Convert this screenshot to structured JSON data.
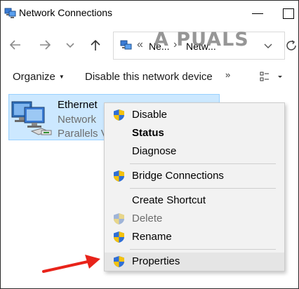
{
  "window": {
    "title": "Network Connections"
  },
  "navigation": {
    "breadcrumbs": [
      "Ne...",
      "Netw..."
    ]
  },
  "watermark": {
    "text": "A  PUALS"
  },
  "toolbar": {
    "organize_label": "Organize",
    "disable_label": "Disable this network device",
    "more_glyph": "»"
  },
  "connection": {
    "name": "Ethernet",
    "status": "Network",
    "device": "Parallels Vi"
  },
  "context_menu": {
    "items": [
      {
        "label": "Disable",
        "shield": true,
        "bold": false,
        "disabled": false
      },
      {
        "label": "Status",
        "shield": false,
        "bold": true,
        "disabled": false
      },
      {
        "label": "Diagnose",
        "shield": false,
        "bold": false,
        "disabled": false
      },
      {
        "label": "Bridge Connections",
        "shield": true,
        "bold": false,
        "disabled": false
      },
      {
        "label": "Create Shortcut",
        "shield": false,
        "bold": false,
        "disabled": false
      },
      {
        "label": "Delete",
        "shield": true,
        "bold": false,
        "disabled": true
      },
      {
        "label": "Rename",
        "shield": true,
        "bold": false,
        "disabled": false
      },
      {
        "label": "Properties",
        "shield": true,
        "bold": false,
        "disabled": false,
        "highlighted": true
      }
    ]
  },
  "colors": {
    "selection_fill": "#cce8ff",
    "selection_border": "#99d1ff",
    "menu_background": "#f2f2f2",
    "arrow": "#e8231a",
    "shield_blue": "#2f6fd6",
    "shield_yellow": "#f4c20d"
  }
}
